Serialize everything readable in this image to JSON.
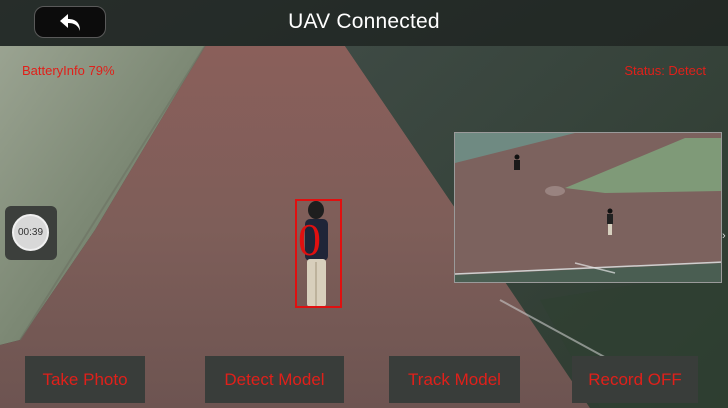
{
  "topbar": {
    "back_icon": "back-arrow-icon",
    "title": "UAV Connected"
  },
  "hud": {
    "battery": "BatteryInfo 79%",
    "status": "Status: Detect",
    "timer": "00:39"
  },
  "detection": {
    "label": "0",
    "box_color": "#e01010"
  },
  "buttons": {
    "take_photo": "Take Photo",
    "detect_model": "Detect Model",
    "track_model": "Track Model",
    "record": "Record OFF"
  },
  "colors": {
    "hud_text": "#e0201a",
    "button_bg": "#393d3a",
    "title_text": "#ffffff"
  }
}
